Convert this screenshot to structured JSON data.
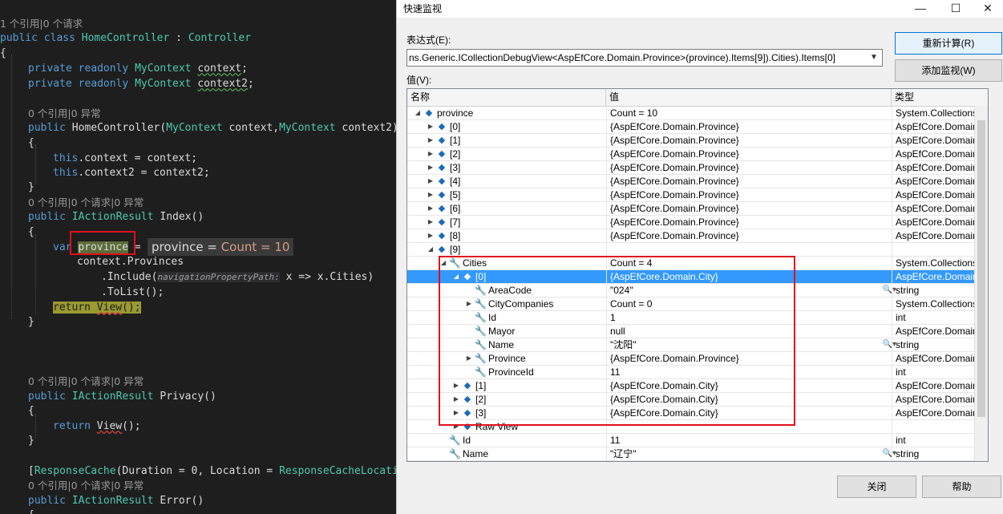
{
  "editor": {
    "lines": {
      "l1": "1 个引用|0 个请求",
      "l2_kw": "public class ",
      "l2_type": "HomeController",
      "l2_rest": " : ",
      "l2_base": "Controller",
      "brace_open": "{",
      "brace_close": "}",
      "f1_kw": "private readonly ",
      "f1_type": "MyContext",
      "f1_name": "context",
      "f1_end": ";",
      "f2_kw": "private readonly ",
      "f2_type": "MyContext",
      "f2_name": "context2",
      "f2_end": ";",
      "lens_ctor": "0 个引用|0 异常",
      "ctor_kw": "public ",
      "ctor_name": "HomeController(",
      "ctor_t1": "MyContext",
      "ctor_p1": " context,",
      "ctor_t2": "MyContext",
      "ctor_p2": " context2)",
      "a1_kw": "this",
      "a1_rest": ".context = context;",
      "a2_kw": "this",
      "a2_rest": ".context2 = context2;",
      "lens_index": "0 个引用|0 个请求|0 异常",
      "idx_kw": "public ",
      "idx_type": "IActionResult",
      "idx_name": " Index()",
      "var_kw": "var",
      "var_name": "province",
      "var_eq": " =",
      "tip_name": "province",
      "tip_eq": " = ",
      "tip_val": "Count = 10",
      "ctx_line": "context.Provinces",
      "inc_pre": ".Include(",
      "inc_hint": "navigationPropertyPath:",
      "inc_post": " x => x.Cities)",
      "tolist": ".ToList();",
      "ret_kw": "return ",
      "ret_view": "View",
      "ret_end": "();",
      "lens_privacy": "0 个引用|0 个请求|0 异常",
      "priv_kw": "public ",
      "priv_type": "IActionResult",
      "priv_name": " Privacy()",
      "ret2_kw": "return ",
      "ret2_view": "View",
      "ret2_end": "();",
      "attr_open": "[",
      "attr_type": "ResponseCache",
      "attr_rest": "(Duration = 0, Location = ",
      "attr_loc": "ResponseCacheLocatio",
      "lens_error": "0 个引用|0 个请求|0 异常",
      "err_kw": "public ",
      "err_type": "IActionResult",
      "err_name": " Error()"
    }
  },
  "quickwatch": {
    "title": "快速监视",
    "window_buttons": {
      "minimize": "—",
      "maximize": "☐",
      "close": "✕"
    },
    "expression_label": "表达式(E):",
    "expression_value": "ns.Generic.ICollectionDebugView<AspEfCore.Domain.Province>(province).Items[9]).Cities).Items[0]",
    "recalc_label": "重新计算(R)",
    "add_watch_label": "添加监视(W)",
    "value_label": "值(V):",
    "columns": {
      "name": "名称",
      "value": "值",
      "type": "类型"
    },
    "rows": [
      {
        "name": "province",
        "value": "Count = 10",
        "type": "System.Collections....",
        "exp": "◢",
        "icon": "cube"
      },
      {
        "name": "[0]",
        "value": "{AspEfCore.Domain.Province}",
        "type": "AspEfCore.Domain....",
        "exp": "▶",
        "icon": "cube"
      },
      {
        "name": "[1]",
        "value": "{AspEfCore.Domain.Province}",
        "type": "AspEfCore.Domain....",
        "exp": "▶",
        "icon": "cube"
      },
      {
        "name": "[2]",
        "value": "{AspEfCore.Domain.Province}",
        "type": "AspEfCore.Domain....",
        "exp": "▶",
        "icon": "cube"
      },
      {
        "name": "[3]",
        "value": "{AspEfCore.Domain.Province}",
        "type": "AspEfCore.Domain....",
        "exp": "▶",
        "icon": "cube"
      },
      {
        "name": "[4]",
        "value": "{AspEfCore.Domain.Province}",
        "type": "AspEfCore.Domain....",
        "exp": "▶",
        "icon": "cube"
      },
      {
        "name": "[5]",
        "value": "{AspEfCore.Domain.Province}",
        "type": "AspEfCore.Domain....",
        "exp": "▶",
        "icon": "cube"
      },
      {
        "name": "[6]",
        "value": "{AspEfCore.Domain.Province}",
        "type": "AspEfCore.Domain....",
        "exp": "▶",
        "icon": "cube"
      },
      {
        "name": "[7]",
        "value": "{AspEfCore.Domain.Province}",
        "type": "AspEfCore.Domain....",
        "exp": "▶",
        "icon": "cube"
      },
      {
        "name": "[8]",
        "value": "{AspEfCore.Domain.Province}",
        "type": "AspEfCore.Domain....",
        "exp": "▶",
        "icon": "cube"
      },
      {
        "name": "[9]",
        "value": "",
        "type": "",
        "exp": "◢",
        "icon": "cube"
      },
      {
        "name": "Cities",
        "value": "Count = 4",
        "type": "System.Collections....",
        "exp": "◢",
        "icon": "wrench"
      },
      {
        "name": "[0]",
        "value": "{AspEfCore.Domain.City}",
        "type": "AspEfCore.Domain....",
        "exp": "◢",
        "icon": "cube"
      },
      {
        "name": "AreaCode",
        "value": "\"024\"",
        "type": "string",
        "exp": "",
        "icon": "wrench"
      },
      {
        "name": "CityCompanies",
        "value": "Count = 0",
        "type": "System.Collections....",
        "exp": "▶",
        "icon": "wrench"
      },
      {
        "name": "Id",
        "value": "1",
        "type": "int",
        "exp": "",
        "icon": "wrench"
      },
      {
        "name": "Mayor",
        "value": "null",
        "type": "AspEfCore.Domain....",
        "exp": "",
        "icon": "wrench"
      },
      {
        "name": "Name",
        "value": "\"沈阳\"",
        "type": "string",
        "exp": "",
        "icon": "wrench"
      },
      {
        "name": "Province",
        "value": "{AspEfCore.Domain.Province}",
        "type": "AspEfCore.Domain....",
        "exp": "▶",
        "icon": "wrench"
      },
      {
        "name": "ProvinceId",
        "value": "11",
        "type": "int",
        "exp": "",
        "icon": "wrench"
      },
      {
        "name": "[1]",
        "value": "{AspEfCore.Domain.City}",
        "type": "AspEfCore.Domain....",
        "exp": "▶",
        "icon": "cube"
      },
      {
        "name": "[2]",
        "value": "{AspEfCore.Domain.City}",
        "type": "AspEfCore.Domain....",
        "exp": "▶",
        "icon": "cube"
      },
      {
        "name": "[3]",
        "value": "{AspEfCore.Domain.City}",
        "type": "AspEfCore.Domain....",
        "exp": "▶",
        "icon": "cube"
      },
      {
        "name": "Raw View",
        "value": "",
        "type": "",
        "exp": "▶",
        "icon": "cube"
      },
      {
        "name": "Id",
        "value": "11",
        "type": "int",
        "exp": "",
        "icon": "wrench"
      },
      {
        "name": "Name",
        "value": "\"辽宁\"",
        "type": "string",
        "exp": "",
        "icon": "wrench"
      }
    ],
    "close_label": "关闭",
    "help_label": "帮助"
  }
}
